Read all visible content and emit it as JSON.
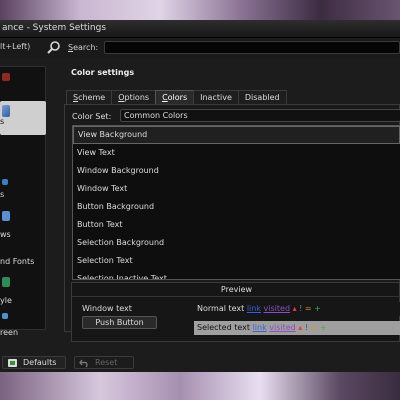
{
  "window": {
    "title": "ance - System Settings"
  },
  "toolbar": {
    "shortcut_hint": "lt+Left)",
    "search_label_accel": "S",
    "search_label_rest": "earch:",
    "search_value": "",
    "search_icon": "magnifier-icon"
  },
  "sidebar": {
    "items": [
      {
        "label": "",
        "icon": "appearance-icon",
        "color": "#c0392b"
      },
      {
        "label": "s",
        "icon": "colors-icon",
        "color": "#7aa0d8",
        "selected": true
      },
      {
        "label": "",
        "icon": "style-icon",
        "color": "#d0d0d0"
      },
      {
        "label": "s",
        "icon": "icons-icon",
        "color": "#4d9ad6"
      },
      {
        "label": "ws",
        "icon": "windows-icon",
        "color": "#5b8fd1"
      },
      {
        "label": "nd Fonts",
        "icon": "fonts-icon",
        "color": "#e0c060"
      },
      {
        "label": "yle",
        "icon": "launch-feedback-icon",
        "color": "#2e8b57"
      },
      {
        "label": "reen",
        "icon": "splash-screen-icon",
        "color": "#5090d0"
      }
    ]
  },
  "content": {
    "section_title": "Color settings",
    "tabs": [
      {
        "label": "Scheme",
        "accel": "S",
        "rest": "cheme"
      },
      {
        "label": "Options",
        "accel": "O",
        "rest": "ptions"
      },
      {
        "label": "Colors",
        "accel": "C",
        "rest": "olors",
        "active": true
      },
      {
        "label": "Inactive",
        "accel": "",
        "rest": "Inactive"
      },
      {
        "label": "Disabled",
        "accel": "",
        "rest": "Disabled"
      }
    ],
    "color_set_label": "Color Set:",
    "color_set_value": "Common Colors",
    "color_list": [
      "View Background",
      "View Text",
      "Window Background",
      "Window Text",
      "Button Background",
      "Button Text",
      "Selection Background",
      "Selection Text",
      "Selection Inactive Text"
    ]
  },
  "preview": {
    "title": "Preview",
    "window_text": "Window text",
    "push_button": "Push Button",
    "normal_text": "Normal text",
    "selected_text": "Selected text",
    "link": "link",
    "visited": "visited",
    "neg_symbol": "▴",
    "inactive_symbol": "!",
    "neutral_symbol": "=",
    "pos_symbol": "+"
  },
  "bottom": {
    "defaults_label": "Defaults",
    "reset_label": "Reset"
  },
  "colors": {
    "window_bg": "#1c1c1c",
    "selected_bg": "#9f9f9f",
    "link": "#3c5fd6",
    "visited": "#8a4fc2"
  }
}
